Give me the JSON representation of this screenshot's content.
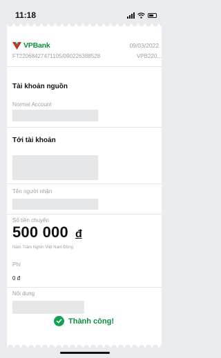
{
  "status_bar": {
    "time": "11:18"
  },
  "receipt": {
    "brand": "VPBank",
    "date": "09/03/2022",
    "transaction_ref": "FT22068427471105/090226388528",
    "bank_code": "VPB220...",
    "source_account": {
      "title": "Tài khoản nguồn",
      "label": "Normal Account"
    },
    "destination_account": {
      "title": "Tới tài khoản"
    },
    "recipient": {
      "label": "Tên người nhận"
    },
    "amount": {
      "label": "Số tiền chuyển",
      "value": "500 000",
      "currency": "đ",
      "in_words": "Năm Trăm Nghìn Việt Nam Đồng"
    },
    "fee": {
      "label": "Phí",
      "value": "0 đ"
    },
    "content": {
      "label": "Nội dung"
    },
    "status": "Thành công!"
  },
  "colors": {
    "brand_green": "#0a8f3e",
    "brand_red": "#d7271f",
    "success": "#12a150"
  }
}
